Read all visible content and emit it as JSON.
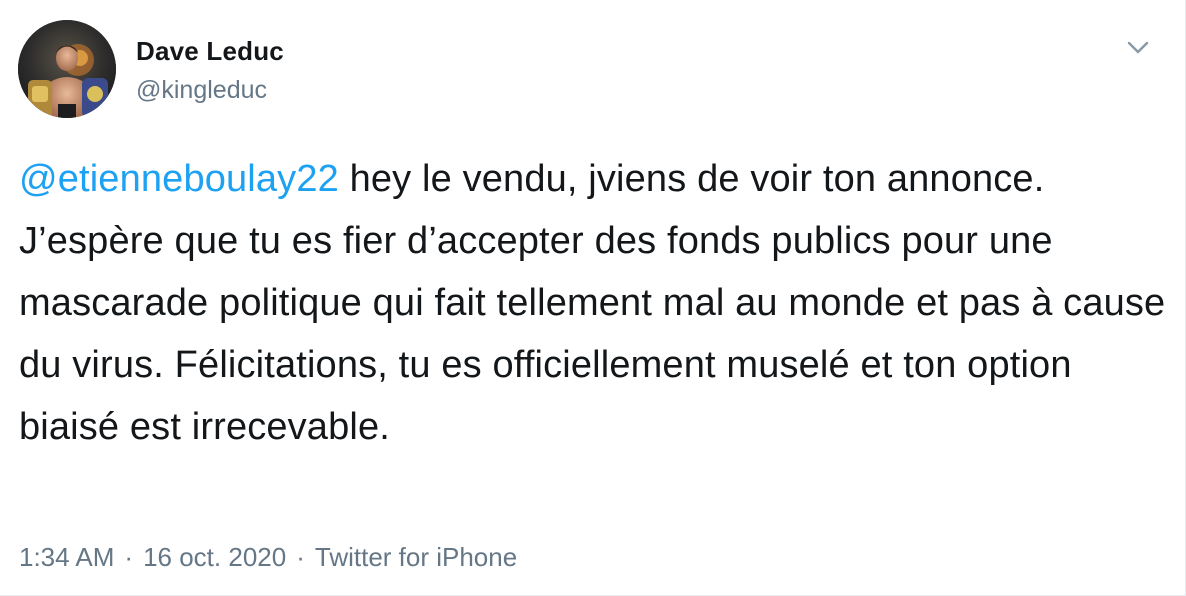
{
  "author": {
    "display_name": "Dave Leduc",
    "handle": "@kingleduc",
    "avatar_icon": "profile-photo-fighter-with-belts"
  },
  "menu": {
    "icon": "chevron-down-icon"
  },
  "tweet": {
    "mention": "@etienneboulay22",
    "text": " hey le vendu, jviens de voir ton annonce. J’espère que tu es fier d’accepter des fonds publics pour une mascarade politique qui fait tellement mal au monde et pas à cause du virus. Félicitations, tu es officiellement muselé et ton option biaisé est irrecevable."
  },
  "meta": {
    "time": "1:34 AM",
    "separator": "·",
    "date": "16 oct. 2020",
    "source": "Twitter for iPhone"
  },
  "colors": {
    "text": "#14171a",
    "secondary": "#657786",
    "link": "#1da1f2",
    "background": "#ffffff"
  }
}
